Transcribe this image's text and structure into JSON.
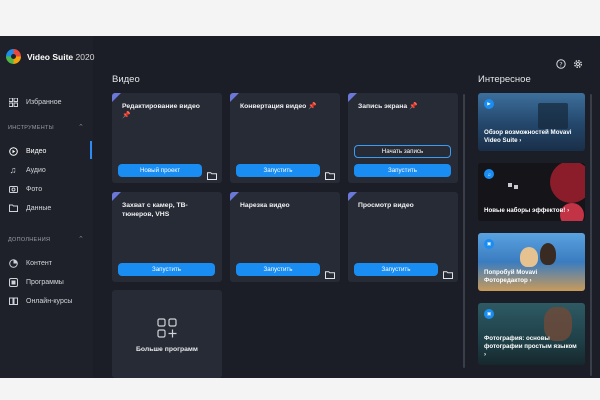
{
  "app": {
    "name": "Video Suite",
    "year": "2020"
  },
  "sidebar": {
    "favorites": "Избранное",
    "tools_header": "ИНСТРУМЕНТЫ",
    "tools": [
      "Видео",
      "Аудио",
      "Фото",
      "Данные"
    ],
    "extras_header": "ДОПОЛНЕНИЯ",
    "extras": [
      "Контент",
      "Программы",
      "Онлайн-курсы"
    ]
  },
  "main": {
    "title": "Видео",
    "cards": [
      {
        "title": "Редактирование видео",
        "button": "Новый проект"
      },
      {
        "title": "Конвертация видео",
        "button": "Запустить"
      },
      {
        "title": "Запись экрана",
        "secondary": "Начать запись",
        "button": "Запустить"
      },
      {
        "title": "Захват с камер, ТВ-тюнеров, VHS",
        "button": "Запустить"
      },
      {
        "title": "Нарезка видео",
        "button": "Запустить"
      },
      {
        "title": "Просмотр видео",
        "button": "Запустить"
      }
    ],
    "more": "Больше программ"
  },
  "interesting": {
    "title": "Интересное",
    "tiles": [
      {
        "caption": "Обзор возможностей Movavi Video Suite ›",
        "color": "#2a5b86"
      },
      {
        "caption": "Новые наборы эффектов! ›",
        "color": "#141419"
      },
      {
        "caption": "Попробуй Movavi Фоторедактор ›",
        "color": "#3b7cc0"
      },
      {
        "caption": "Фотография: основы фотографии простым языком ›",
        "color": "#1f4048"
      }
    ]
  },
  "colors": {
    "accent": "#1a8df2",
    "bg": "#1b1e26",
    "card": "#272b35"
  }
}
